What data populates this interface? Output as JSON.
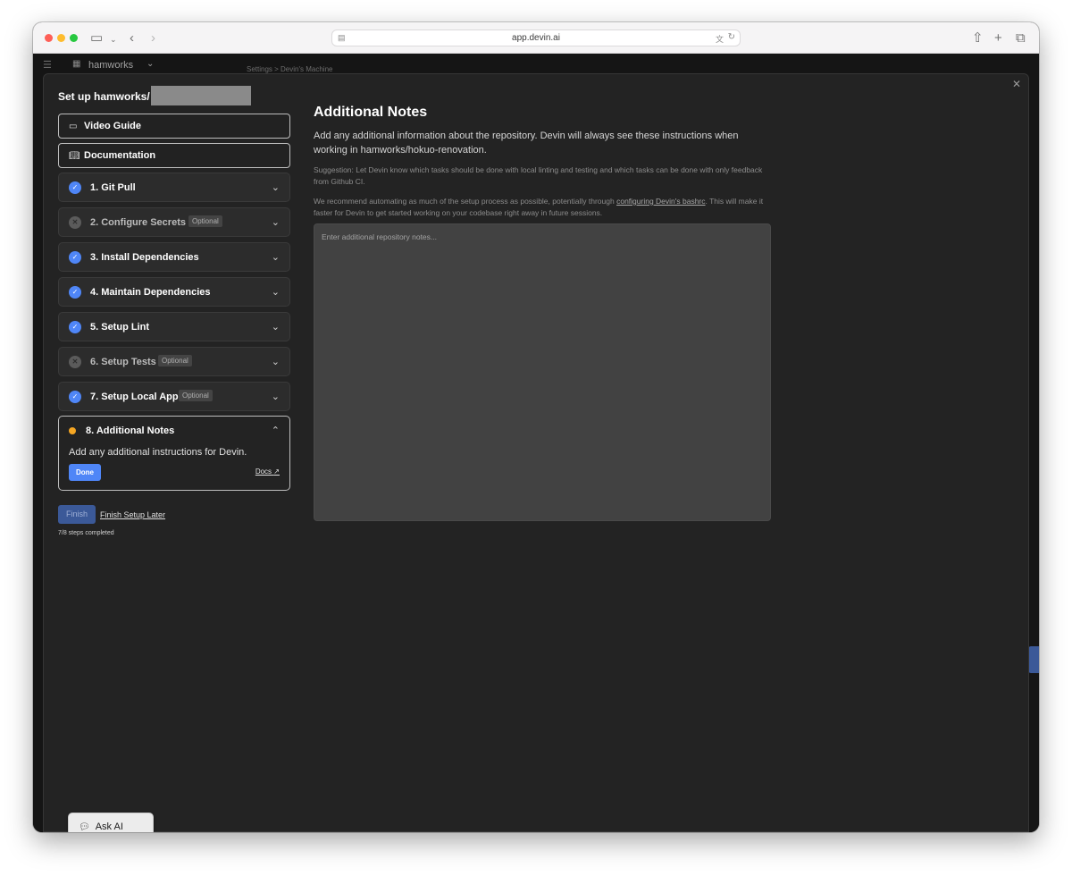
{
  "browser": {
    "url": "app.devin.ai"
  },
  "app_header": {
    "org_name": "hamworks",
    "breadcrumb": "Settings  >  Devin's Machine"
  },
  "setup": {
    "title": "Set up hamworks/",
    "video_guide": "Video Guide",
    "documentation": "Documentation",
    "optional_badge": "Optional",
    "steps": [
      {
        "label": "1. Git Pull",
        "status": "done"
      },
      {
        "label": "2. Configure Secrets",
        "status": "skipped",
        "optional": true
      },
      {
        "label": "3. Install Dependencies",
        "status": "done"
      },
      {
        "label": "4. Maintain Dependencies",
        "status": "done"
      },
      {
        "label": "5. Setup Lint",
        "status": "done"
      },
      {
        "label": "6. Setup Tests",
        "status": "skipped",
        "optional": true
      },
      {
        "label": "7. Setup Local App",
        "status": "done",
        "optional": true
      }
    ],
    "active_step": {
      "label": "8. Additional Notes",
      "description": "Add any additional instructions for Devin.",
      "done_button": "Done",
      "docs_link": "Docs"
    },
    "finish_button": "Finish",
    "finish_later": "Finish Setup Later",
    "progress": "7/8 steps completed"
  },
  "notes": {
    "title": "Additional Notes",
    "intro": "Add any additional information about the repository. Devin will always see these instructions when working in hamworks/hokuo-renovation.",
    "suggestion": "Suggestion: Let Devin know which tasks should be done with local linting and testing and which tasks can be done with only feedback from Github CI.",
    "recommend_prefix": "We recommend automating as much of the setup process as possible, potentially through ",
    "recommend_link": "configuring Devin's bashrc",
    "recommend_suffix": ". This will make it faster for Devin to get started working on your codebase right away in future sessions.",
    "placeholder": "Enter additional repository notes..."
  },
  "ask_ai": {
    "label": "Ask AI"
  },
  "colors": {
    "accent": "#4f86f7",
    "in_progress": "#f5a623",
    "background": "#232323"
  }
}
